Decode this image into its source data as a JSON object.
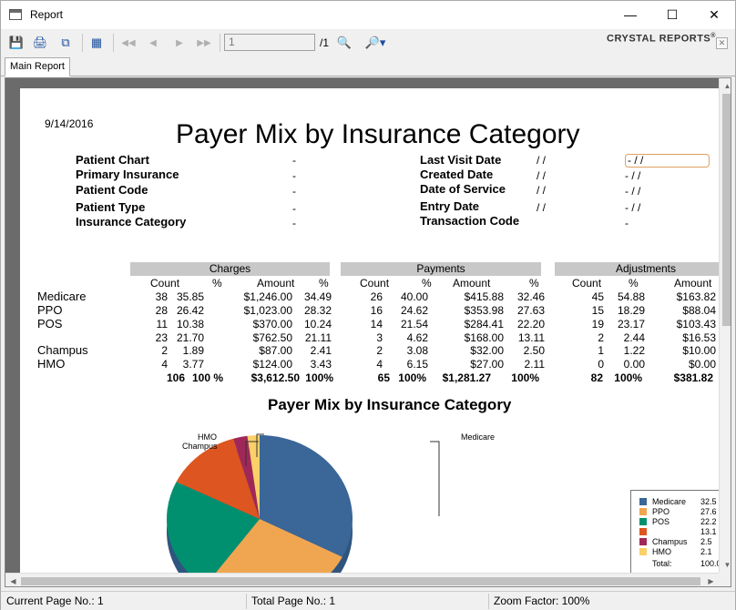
{
  "window": {
    "title": "Report",
    "icon": "report-window-icon"
  },
  "toolbar": {
    "page_value": "1",
    "page_count": "/1",
    "brand": "CRYSTAL REPORTS",
    "brand_mark": "®"
  },
  "tabs": [
    {
      "label": "Main Report"
    }
  ],
  "report": {
    "date": "9/14/2016",
    "title": "Payer Mix by Insurance Category",
    "params_left": [
      {
        "label": "Patient Chart",
        "value": "-"
      },
      {
        "label": "Primary Insurance",
        "value": "-"
      },
      {
        "label": "Patient Code",
        "value": "-"
      },
      {
        "label": "Patient Type",
        "value": "-"
      },
      {
        "label": "Insurance Category",
        "value": "-"
      }
    ],
    "params_right": [
      {
        "label": "Last Visit Date",
        "from": "/ /",
        "to": "-  / /"
      },
      {
        "label": "Created Date",
        "from": "/ /",
        "to": "-  / /"
      },
      {
        "label": "Date of Service",
        "from": "/ /",
        "to": "-  / /"
      },
      {
        "label": "Entry Date",
        "from": "/ /",
        "to": "-  / /"
      },
      {
        "label": "Transaction Code",
        "from": "",
        "to": "-"
      }
    ],
    "sections": [
      "Charges",
      "Payments",
      "Adjustments"
    ],
    "col_headers": {
      "count": "Count",
      "pct": "%",
      "amount": "Amount"
    },
    "rows": [
      {
        "cat": "Medicare",
        "c_count": "38",
        "c_pct": "35.85",
        "c_amt": "$1,246.00",
        "c_apct": "34.49",
        "p_count": "26",
        "p_pct": "40.00",
        "p_amt": "$415.88",
        "p_apct": "32.46",
        "a_count": "45",
        "a_pct": "54.88",
        "a_amt": "$163.82"
      },
      {
        "cat": "PPO",
        "c_count": "28",
        "c_pct": "26.42",
        "c_amt": "$1,023.00",
        "c_apct": "28.32",
        "p_count": "16",
        "p_pct": "24.62",
        "p_amt": "$353.98",
        "p_apct": "27.63",
        "a_count": "15",
        "a_pct": "18.29",
        "a_amt": "$88.04"
      },
      {
        "cat": "POS",
        "c_count": "11",
        "c_pct": "10.38",
        "c_amt": "$370.00",
        "c_apct": "10.24",
        "p_count": "14",
        "p_pct": "21.54",
        "p_amt": "$284.41",
        "p_apct": "22.20",
        "a_count": "19",
        "a_pct": "23.17",
        "a_amt": "$103.43"
      },
      {
        "cat": "",
        "c_count": "23",
        "c_pct": "21.70",
        "c_amt": "$762.50",
        "c_apct": "21.11",
        "p_count": "3",
        "p_pct": "4.62",
        "p_amt": "$168.00",
        "p_apct": "13.11",
        "a_count": "2",
        "a_pct": "2.44",
        "a_amt": "$16.53"
      },
      {
        "cat": "Champus",
        "c_count": "2",
        "c_pct": "1.89",
        "c_amt": "$87.00",
        "c_apct": "2.41",
        "p_count": "2",
        "p_pct": "3.08",
        "p_amt": "$32.00",
        "p_apct": "2.50",
        "a_count": "1",
        "a_pct": "1.22",
        "a_amt": "$10.00"
      },
      {
        "cat": "HMO",
        "c_count": "4",
        "c_pct": "3.77",
        "c_amt": "$124.00",
        "c_apct": "3.43",
        "p_count": "4",
        "p_pct": "6.15",
        "p_amt": "$27.00",
        "p_apct": "2.11",
        "a_count": "0",
        "a_pct": "0.00",
        "a_amt": "$0.00"
      }
    ],
    "totals": {
      "c_count": "106",
      "c_pct": "100 %",
      "c_amt": "$3,612.50",
      "c_apct": "100%",
      "p_count": "65",
      "p_pct": "100%",
      "p_amt": "$1,281.27",
      "p_apct": "100%",
      "a_count": "82",
      "a_pct": "100%",
      "a_amt": "$381.82"
    }
  },
  "chart_data": {
    "type": "pie",
    "title": "Payer Mix by Insurance Category",
    "categories": [
      "Medicare",
      "PPO",
      "POS",
      "",
      "Champus",
      "HMO"
    ],
    "values": [
      32.5,
      27.6,
      22.2,
      13.1,
      2.5,
      2.1
    ],
    "value_labels": [
      "32.5",
      "27.6",
      "22.2",
      "13.1",
      "2.5",
      "2.1"
    ],
    "colors": [
      "#3a6698",
      "#f0a650",
      "#009070",
      "#dd5520",
      "#a02858",
      "#fcd068"
    ],
    "slice_labels": [
      "Medicare",
      "HMO",
      "Champus"
    ],
    "legend": {
      "position": "right",
      "total_label": "Total:",
      "total_value": "100.0"
    }
  },
  "statusbar": {
    "current_page": "Current Page No.: 1",
    "total_page": "Total Page No.: 1",
    "zoom": "Zoom Factor: 100%"
  }
}
